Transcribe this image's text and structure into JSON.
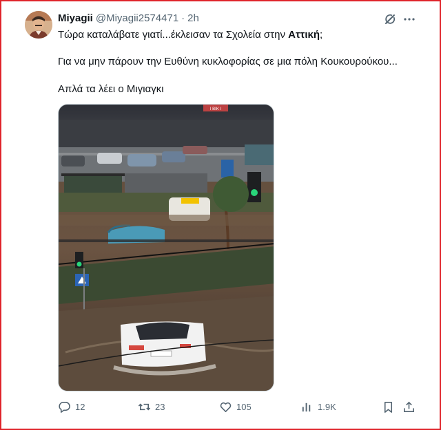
{
  "tweet": {
    "author": {
      "display_name": "Miyagii",
      "handle": "@Miyagii2574471",
      "separator": "·",
      "time": "2h"
    },
    "text": {
      "line1_prefix": "Τώρα καταλάβατε γιατί...έκλεισαν τα Σχολεία στην ",
      "line1_bold": "Αττική",
      "line1_suffix": ";",
      "line2": "Για να μην πάρουν την Ευθύνη κυκλοφορίας σε μια πόλη Κουκουρούκου...",
      "line3": "Απλά τα λέει ο Μιγιαγκι"
    },
    "media": {
      "sign_text": "Ι ΒΙΚ Ι",
      "icon": "flooded-street-photo"
    },
    "metrics": {
      "replies": "12",
      "retweets": "23",
      "likes": "105",
      "views": "1.9K"
    }
  },
  "icons": {
    "grok": "grok-icon",
    "more": "more-icon",
    "reply": "reply-icon",
    "retweet": "retweet-icon",
    "like": "heart-icon",
    "views": "views-icon",
    "bookmark": "bookmark-icon",
    "share": "share-icon"
  },
  "colors": {
    "frame_border": "#e0242b",
    "text_primary": "#0f1419",
    "text_secondary": "#536471"
  }
}
